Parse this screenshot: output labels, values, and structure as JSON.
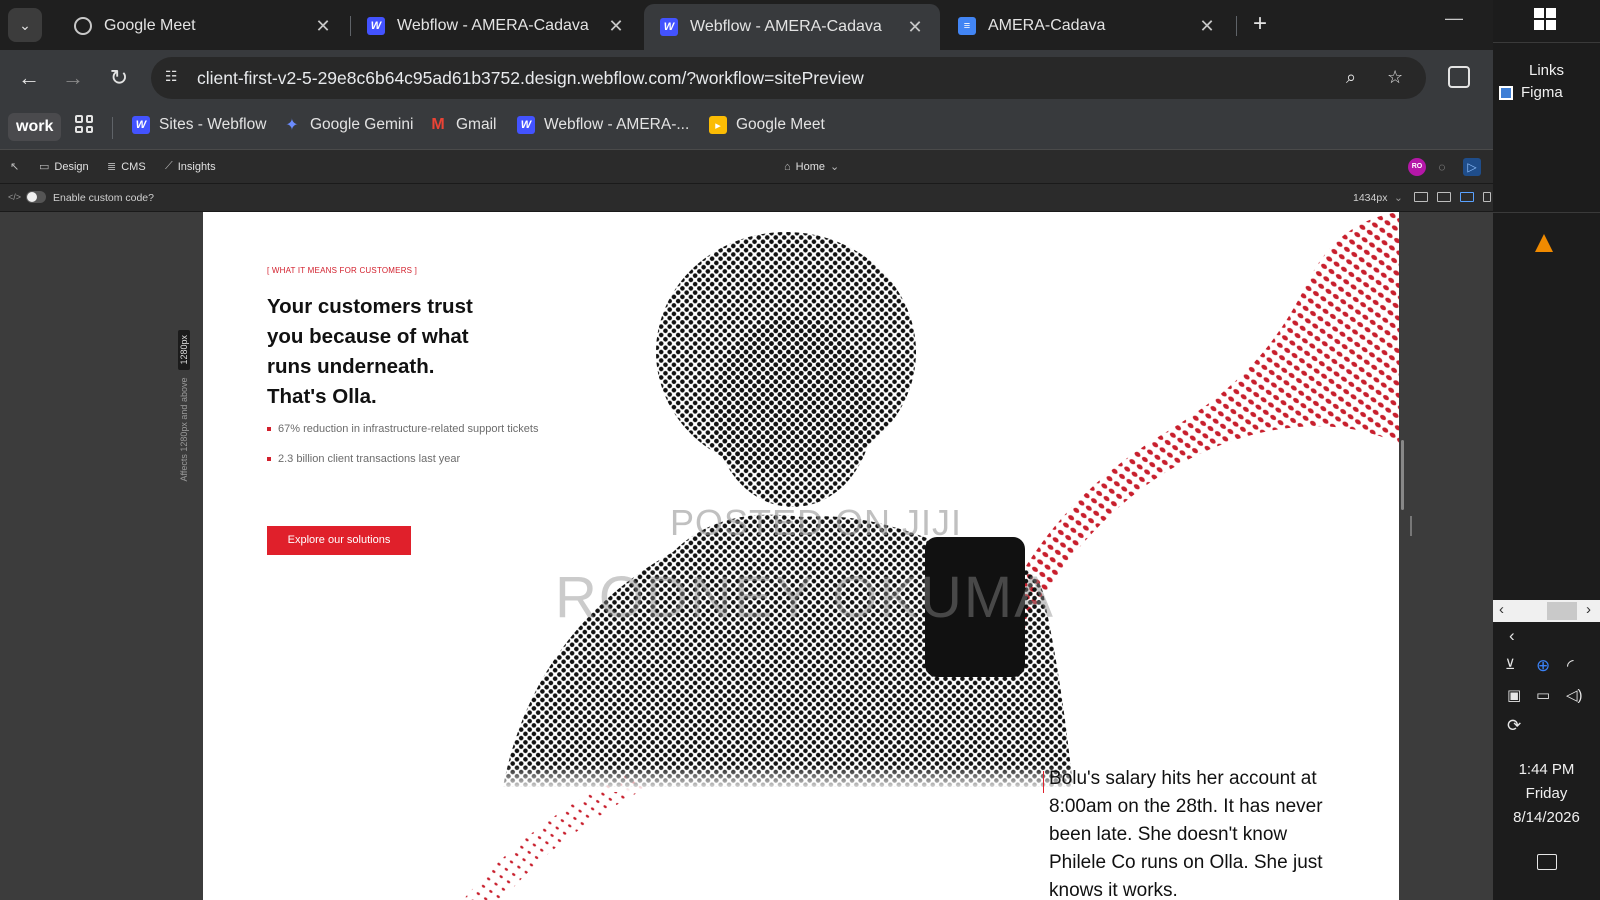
{
  "tabs": [
    {
      "title": "Google Meet",
      "active": false
    },
    {
      "title": "Webflow - AMERA-Cadava",
      "active": false
    },
    {
      "title": "Webflow - AMERA-Cadava",
      "active": true
    },
    {
      "title": "AMERA-Cadava",
      "active": false
    }
  ],
  "address_bar": {
    "url": "client-first-v2-5-29e8c6b64c95ad61b3752.design.webflow.com/?workflow=sitePreview"
  },
  "bookmarks": {
    "profile": "work",
    "items": [
      "Sites - Webflow",
      "Google Gemini",
      "Gmail",
      "Webflow - AMERA-...",
      "Google Meet"
    ]
  },
  "webflow": {
    "modes": [
      "Design",
      "CMS",
      "Insights"
    ],
    "page_selector": "Home",
    "avatar_initials": "RO",
    "custom_code_label": "Enable custom code?",
    "width_value": "1434px",
    "breakpoint_note": "Affects 1280px and above",
    "breakpoint_chip": "1280px"
  },
  "page": {
    "eyebrow": "[ WHAT IT MEANS FOR CUSTOMERS ]",
    "headline": "Your customers trust you because of what runs underneath. That's Olla.",
    "stats": [
      "67% reduction in infrastructure-related support tickets",
      "2.3 billion client transactions last year"
    ],
    "cta_label": "Explore our solutions",
    "story": "Bolu's salary hits her account at 8:00am on the 28th. It has never been late. She doesn't know Philele Co runs on Olla. She just knows it works.",
    "watermark_line1": "POSTED ON JIJI",
    "watermark_line2": "RODNEY OKUMA",
    "accent_color": "#e0202b"
  },
  "taskbar": {
    "links_label": "Links",
    "figma_label": "Figma",
    "time": "1:44 PM",
    "day": "Friday",
    "date": "8/14/2026"
  }
}
